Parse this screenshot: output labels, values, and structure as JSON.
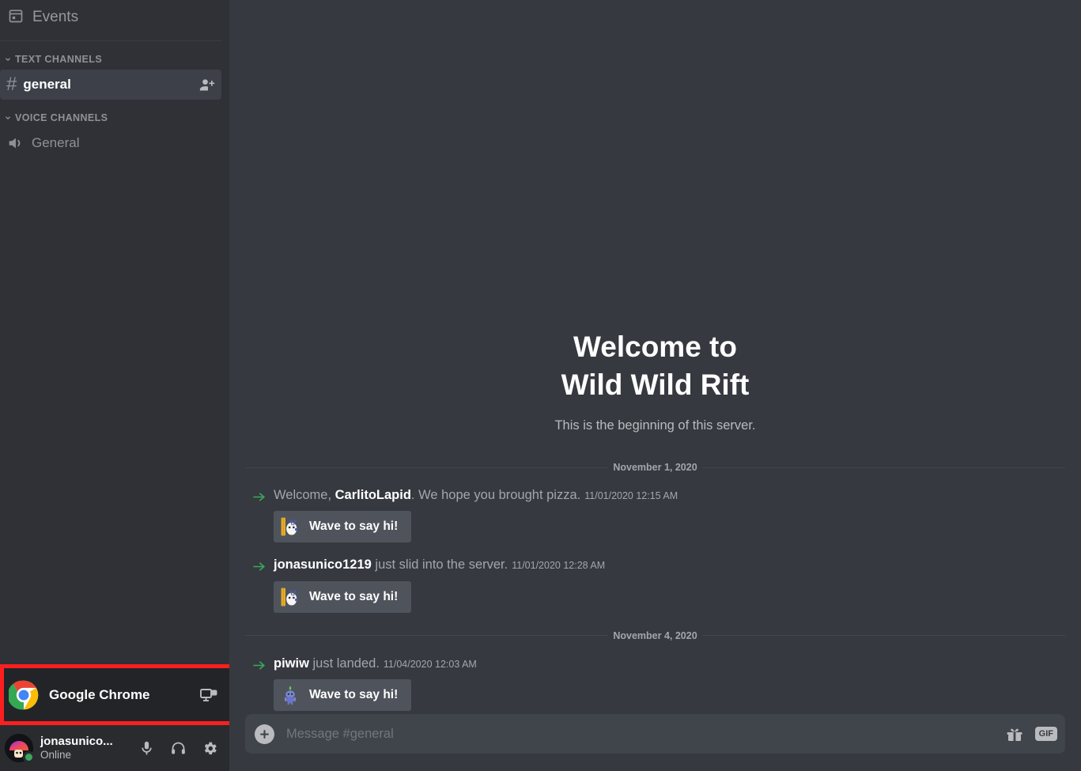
{
  "colors": {
    "sidebar_bg": "#2f3136",
    "main_bg": "#36393f",
    "highlight_border": "#fb1f1f",
    "online_green": "#3ba55d",
    "active_channel_bg": "#3d4048",
    "wave_button_bg": "#4f545c",
    "composer_bg": "#40444b"
  },
  "sidebar": {
    "events": {
      "label": "Events",
      "icon": "calendar-icon"
    },
    "categories": [
      {
        "label": "TEXT CHANNELS",
        "channels": [
          {
            "name": "general",
            "icon": "hash-icon",
            "active": true,
            "action_icon": "person-add-icon"
          }
        ]
      },
      {
        "label": "VOICE CHANNELS",
        "channels": [
          {
            "name": "General",
            "icon": "speaker-icon",
            "active": false
          }
        ]
      }
    ],
    "activity": {
      "app_name": "Google Chrome",
      "icon": "chrome-icon",
      "screen_share_icon": "screen-share-icon",
      "highlighted": true
    },
    "user": {
      "name": "jonasunico...",
      "status": "Online",
      "avatar": "mushroom-avatar",
      "buttons": [
        {
          "name": "microphone-icon"
        },
        {
          "name": "headphones-icon"
        },
        {
          "name": "gear-icon"
        }
      ]
    }
  },
  "main": {
    "welcome": {
      "title_line1": "Welcome to",
      "title_line2": "Wild Wild Rift",
      "subtitle": "This is the beginning of this server."
    },
    "groups": [
      {
        "date": "November 1, 2020",
        "messages": [
          {
            "prefix": "Welcome, ",
            "user": "CarlitoLapid",
            "suffix": ". We hope you brought pizza.",
            "time": "11/01/2020 12:15 AM",
            "wave_label": "Wave to say hi!",
            "wave_emoji": "wumpus-door-emoji"
          },
          {
            "prefix": "",
            "user": "jonasunico1219",
            "suffix": " just slid into the server.",
            "time": "11/01/2020 12:28 AM",
            "wave_label": "Wave to say hi!",
            "wave_emoji": "wumpus-door-emoji"
          }
        ]
      },
      {
        "date": "November 4, 2020",
        "messages": [
          {
            "prefix": "",
            "user": "piwiw",
            "suffix": " just landed.",
            "time": "11/04/2020 12:03 AM",
            "wave_label": "Wave to say hi!",
            "wave_emoji": "wumpus-sprout-emoji"
          }
        ]
      }
    ],
    "composer": {
      "placeholder": "Message #general",
      "value": "",
      "add_icon": "plus-icon",
      "gift_icon": "gift-icon",
      "gif_label": "GIF"
    }
  }
}
